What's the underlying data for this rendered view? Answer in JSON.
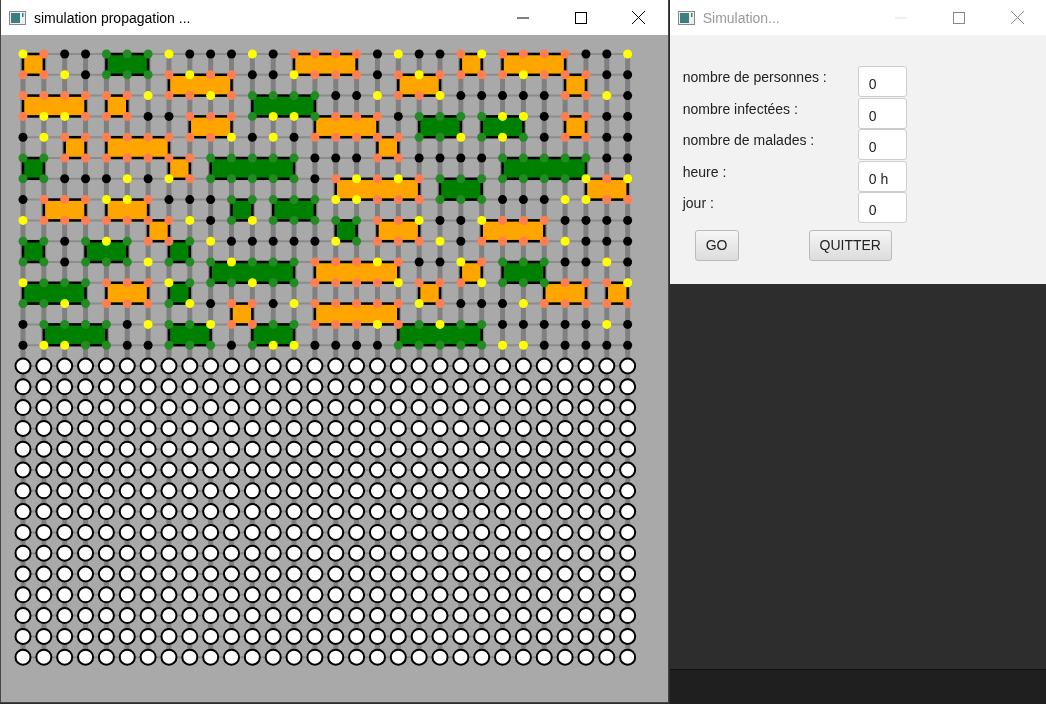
{
  "windows": [
    {
      "title": "simulation propagation ...",
      "active": true,
      "minimize_disabled": false
    },
    {
      "title": "Simulation...",
      "active": false,
      "minimize_disabled": true
    }
  ],
  "form": {
    "fields": [
      {
        "label": "nombre de personnes :",
        "value": "0"
      },
      {
        "label": "nombre infectées :",
        "value": "0"
      },
      {
        "label": "nombre de malades :",
        "value": "0"
      },
      {
        "label": "heure :",
        "value": "0 h"
      },
      {
        "label": "jour :",
        "value": "0"
      }
    ],
    "buttons": [
      "GO",
      "QUITTER"
    ]
  }
}
